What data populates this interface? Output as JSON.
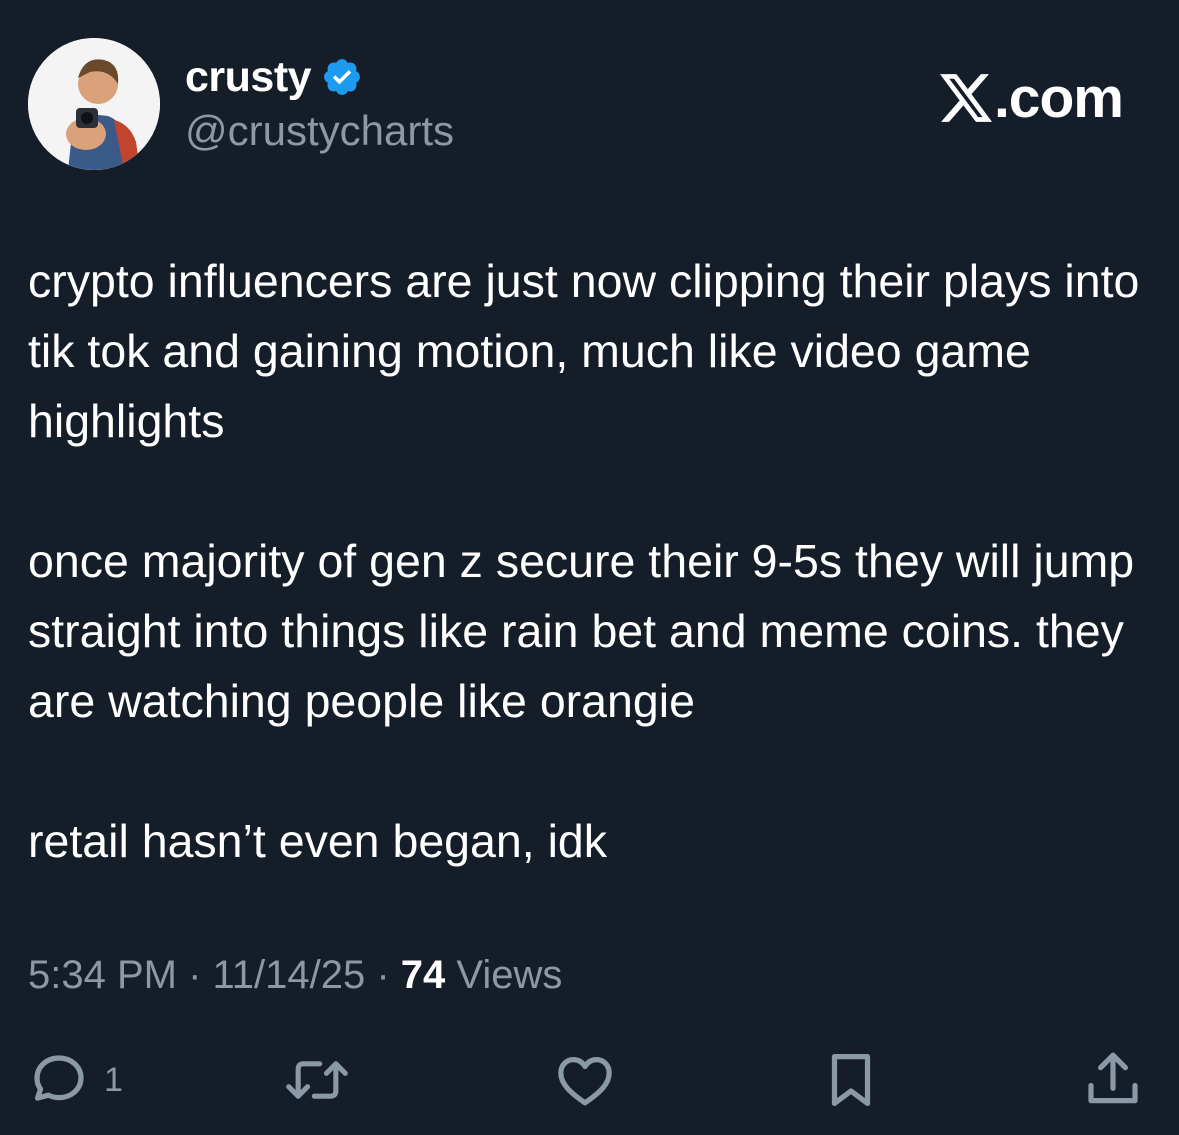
{
  "user": {
    "display_name": "crusty",
    "handle": "@crustycharts",
    "verified_icon": "verified-badge-icon",
    "avatar": "avatar"
  },
  "brand": {
    "text": ".com",
    "icon": "x-logo-icon"
  },
  "tweet": {
    "paragraphs": [
      "crypto influencers are just now clipping their plays into tik tok and gaining motion, much like video game highlights",
      "once majority of gen z secure their 9-5s they will jump straight into things like rain bet and meme coins. they are watching people like orangie",
      "retail hasn’t even began, idk"
    ]
  },
  "meta": {
    "time": "5:34 PM",
    "sep1": " · ",
    "date": "11/14/25",
    "sep2": " · ",
    "views_count": "74",
    "views_label": " Views"
  },
  "actions": {
    "reply_count": "1",
    "icons": [
      "reply-icon",
      "retweet-icon",
      "like-icon",
      "bookmark-icon",
      "share-icon"
    ]
  },
  "colors": {
    "background": "#151d28",
    "text": "#ffffff",
    "secondary": "#8b98a5",
    "verified": "#1d9bf0"
  }
}
